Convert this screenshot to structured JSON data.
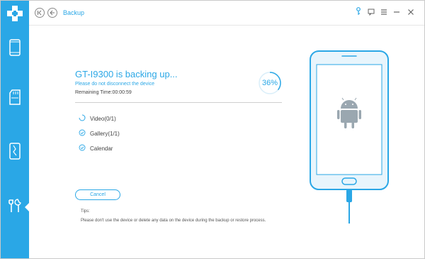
{
  "app": {
    "title": "Backup",
    "accent_color": "#2aa7e6"
  },
  "sidebar": {
    "logo_icon": "plus-cross-logo",
    "items": [
      {
        "icon": "phone-icon"
      },
      {
        "icon": "sd-card-icon"
      },
      {
        "icon": "broken-phone-icon"
      },
      {
        "icon": "tools-icon",
        "active": true
      }
    ]
  },
  "titlebar": {
    "back_first_icon": "first-page-icon",
    "back_icon": "back-arrow-icon",
    "right_icons": [
      "key-icon",
      "chat-icon",
      "menu-icon",
      "minimize-icon",
      "close-icon"
    ]
  },
  "backup": {
    "heading": "GT-I9300 is backing up...",
    "warning": "Please do not disconnect the device",
    "remaining": "Remaining Time:00:00:59",
    "progress_text": "36%",
    "progress": 0.36,
    "items": [
      {
        "label": "Video(0/1)",
        "status": "in-progress"
      },
      {
        "label": "Gallery(1/1)",
        "status": "done"
      },
      {
        "label": "Calendar",
        "status": "done"
      }
    ],
    "cancel_label": "Cancel"
  },
  "tips": {
    "title": "Tips:",
    "text": "Please don't use the device or delete any data on the device during the backup or restore process."
  }
}
